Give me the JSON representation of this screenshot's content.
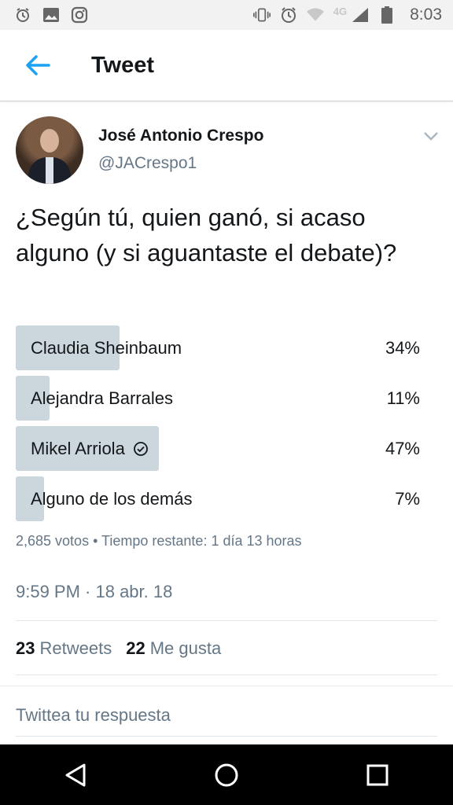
{
  "status_bar": {
    "time": "8:03",
    "network": "4G",
    "icons": [
      "alarm-icon",
      "image-icon",
      "instagram-icon",
      "vibrate-icon",
      "alarm-icon",
      "wifi-icon",
      "signal-icon",
      "battery-icon"
    ]
  },
  "header": {
    "title": "Tweet",
    "back_icon": "arrow-left-icon",
    "accent": "#1da1f2"
  },
  "tweet": {
    "author_name": "José Antonio Crespo",
    "author_handle": "@JACrespo1",
    "text": "¿Según tú, quien ganó, si acaso alguno (y si aguantaste el debate)?",
    "poll": {
      "options": [
        {
          "label": "Claudia Sheinbaum",
          "percent_text": "34%",
          "percent": 34,
          "winner": false
        },
        {
          "label": "Alejandra Barrales",
          "percent_text": "11%",
          "percent": 11,
          "winner": false
        },
        {
          "label": "Mikel Arriola",
          "percent_text": "47%",
          "percent": 47,
          "winner": true
        },
        {
          "label": "Alguno de los demás",
          "percent_text": "7%",
          "percent": 7,
          "winner": false
        }
      ],
      "meta": "2,685 votos • Tiempo restante: 1 día 13 horas",
      "bar_color": "#ccd6dd"
    },
    "timestamp": "9:59 PM · 18 abr. 18",
    "stats": {
      "retweets_count": "23",
      "retweets_label": "Retweets",
      "likes_count": "22",
      "likes_label": "Me gusta"
    }
  },
  "reply": {
    "placeholder": "Twittea tu respuesta"
  },
  "nav_bar": {
    "icons": [
      "back-triangle-icon",
      "home-circle-icon",
      "recents-square-icon"
    ]
  }
}
